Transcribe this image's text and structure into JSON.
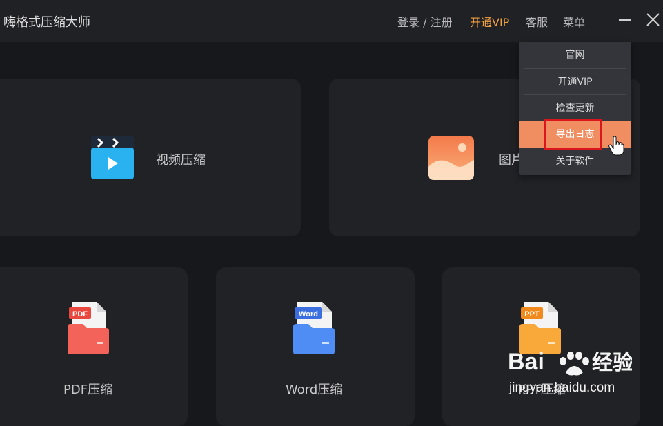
{
  "app": {
    "title": "嗨格式压缩大师"
  },
  "header": {
    "login": "登录 / 注册",
    "vip": "开通VIP",
    "service": "客服",
    "menu": "菜单"
  },
  "menu": {
    "items": [
      {
        "label": "官网"
      },
      {
        "label": "开通VIP"
      },
      {
        "label": "检查更新"
      },
      {
        "label": "导出日志"
      },
      {
        "label": "关于软件"
      }
    ],
    "active_index": 3
  },
  "cards": {
    "video": {
      "label": "视频压缩"
    },
    "image": {
      "label": "图片"
    },
    "pdf": {
      "label": "PDF压缩",
      "badge": "PDF"
    },
    "word": {
      "label": "Word压缩",
      "badge": "Word"
    },
    "ppt": {
      "label": "PPT压缩",
      "badge": "PPT"
    }
  },
  "watermark": {
    "brand": "Bai",
    "brand2": "经验",
    "url": "jingyan.baidu.com"
  },
  "colors": {
    "accent_vip": "#f2a043",
    "menu_active": "#f08e62",
    "highlight": "#d8161c"
  }
}
